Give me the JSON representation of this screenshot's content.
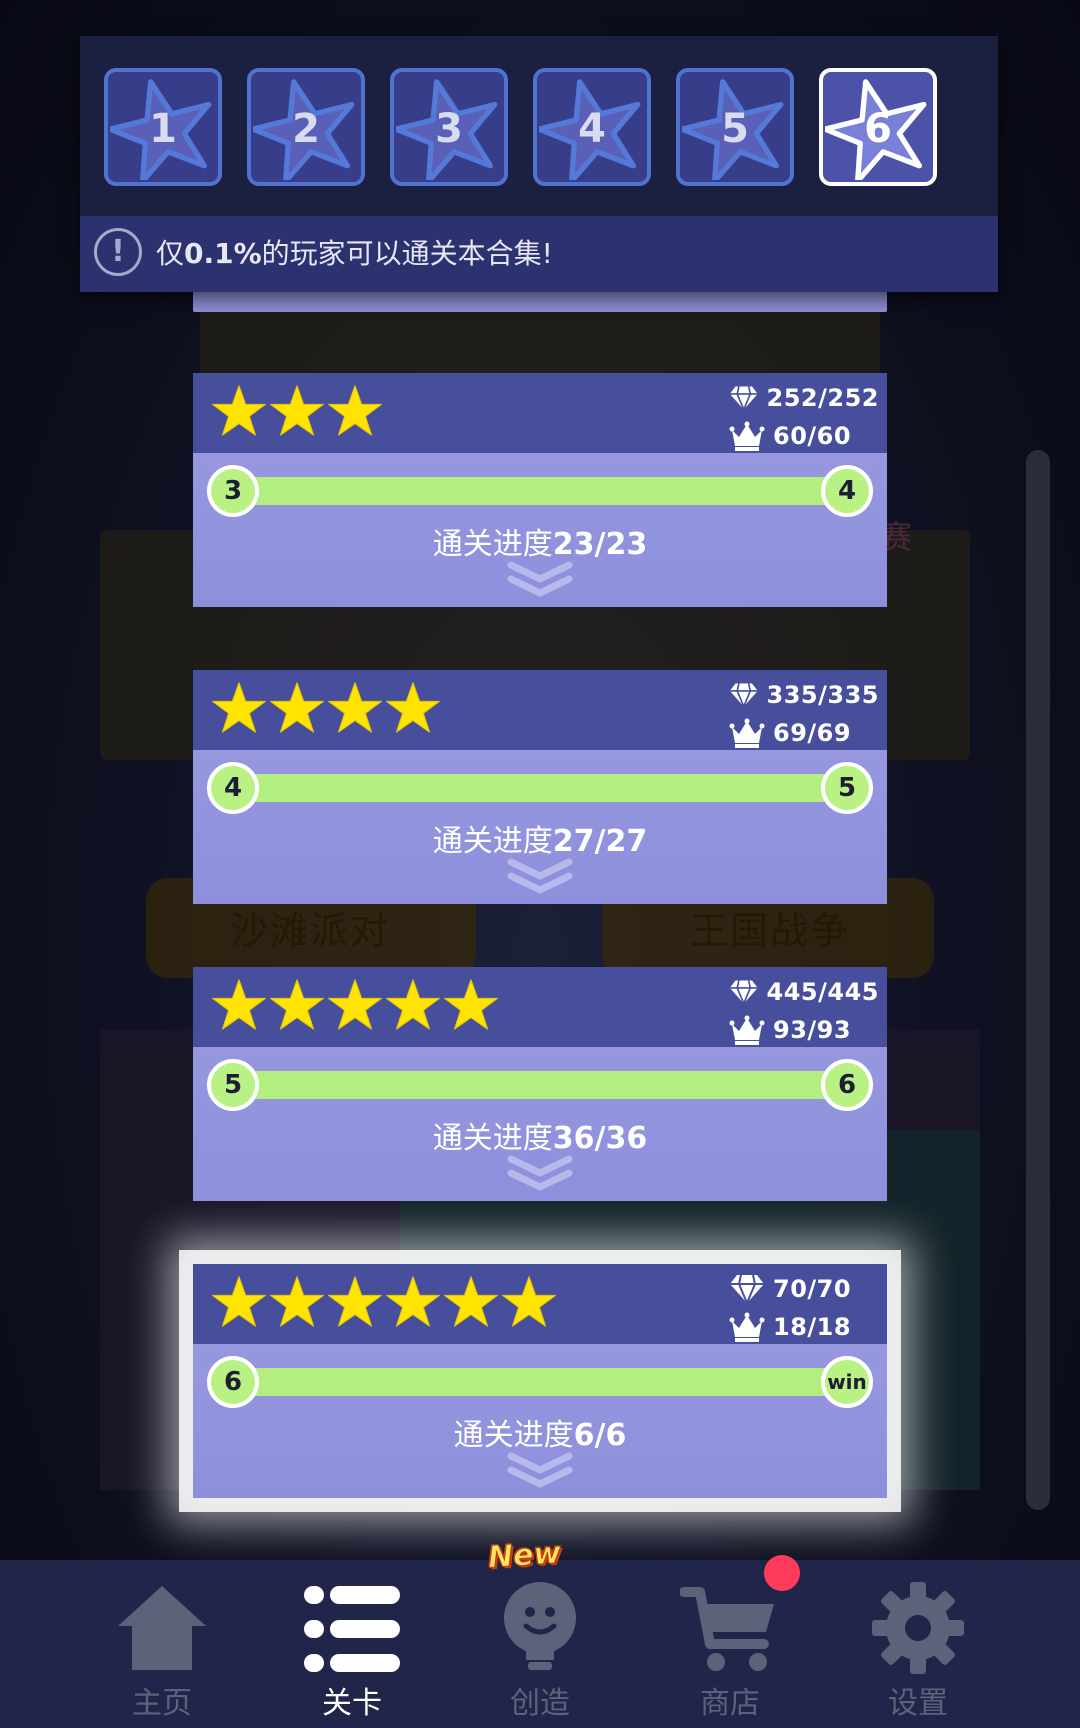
{
  "colors": {
    "card_header": "#474f9c",
    "card_body": "#9a9ce0",
    "track_green": "#b3ee80",
    "star_yellow": "#ffe400",
    "tab_border": "#4f73cf",
    "tab_active_border": "#ffffff",
    "nav_bg": "#22254a",
    "badge_red": "#ff3b5c"
  },
  "tabs": [
    {
      "label": "1",
      "active": false
    },
    {
      "label": "2",
      "active": false
    },
    {
      "label": "3",
      "active": false
    },
    {
      "label": "4",
      "active": false
    },
    {
      "label": "5",
      "active": false
    },
    {
      "label": "6",
      "active": true
    }
  ],
  "notice": {
    "icon": "exclamation-circle-icon",
    "prefix": "仅",
    "highlight": "0.1%",
    "suffix": "的玩家可以通关本合集!"
  },
  "levels": [
    {
      "stars": 3,
      "gems": "252/252",
      "crowns": "60/60",
      "start_node": "3",
      "end_node": "4",
      "progress_label": "通关进度",
      "progress_value": "23/23",
      "highlighted": false
    },
    {
      "stars": 4,
      "gems": "335/335",
      "crowns": "69/69",
      "start_node": "4",
      "end_node": "5",
      "progress_label": "通关进度",
      "progress_value": "27/27",
      "highlighted": false
    },
    {
      "stars": 5,
      "gems": "445/445",
      "crowns": "93/93",
      "start_node": "5",
      "end_node": "6",
      "progress_label": "通关进度",
      "progress_value": "36/36",
      "highlighted": false
    },
    {
      "stars": 6,
      "gems": "70/70",
      "crowns": "18/18",
      "start_node": "6",
      "end_node": "win",
      "progress_label": "通关进度",
      "progress_value": "6/6",
      "highlighted": true
    }
  ],
  "background": {
    "pill_left": "沙滩派对",
    "pill_right": "王国战争",
    "side_text": "赛"
  },
  "nav": {
    "items": [
      {
        "label": "主页",
        "icon": "home-icon",
        "active": false
      },
      {
        "label": "关卡",
        "icon": "list-icon",
        "active": true
      },
      {
        "label": "创造",
        "icon": "lightbulb-icon",
        "active": false
      },
      {
        "label": "商店",
        "icon": "cart-icon",
        "active": false
      },
      {
        "label": "设置",
        "icon": "gear-icon",
        "active": false
      }
    ],
    "new_badge": "New"
  }
}
